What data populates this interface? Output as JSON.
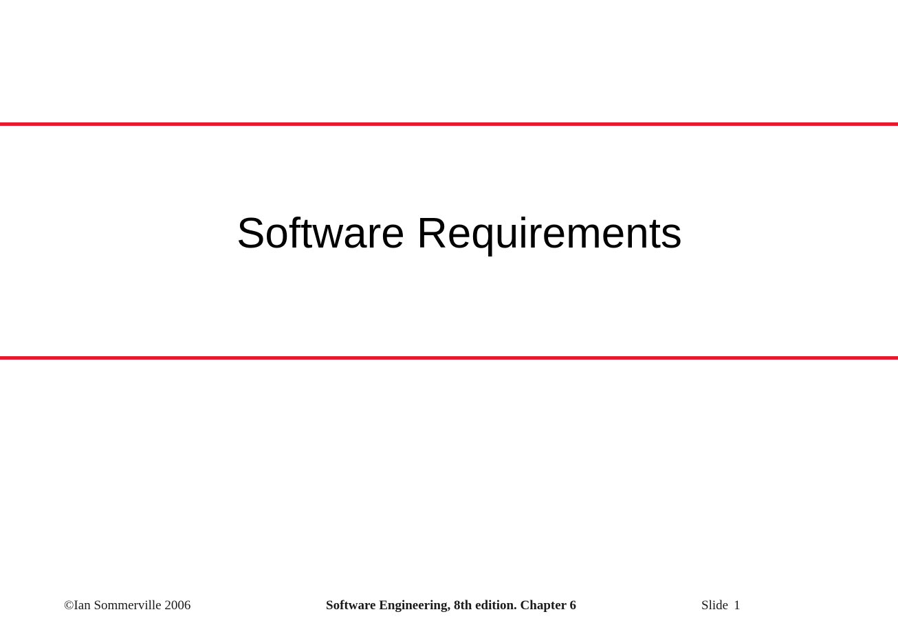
{
  "slide": {
    "title": "Software Requirements",
    "rule_color": "#e8192c"
  },
  "footer": {
    "copyright": "©Ian Sommerville 2006",
    "book": "Software Engineering, 8th edition. Chapter 6",
    "slide_label": "Slide",
    "slide_number": "1"
  }
}
